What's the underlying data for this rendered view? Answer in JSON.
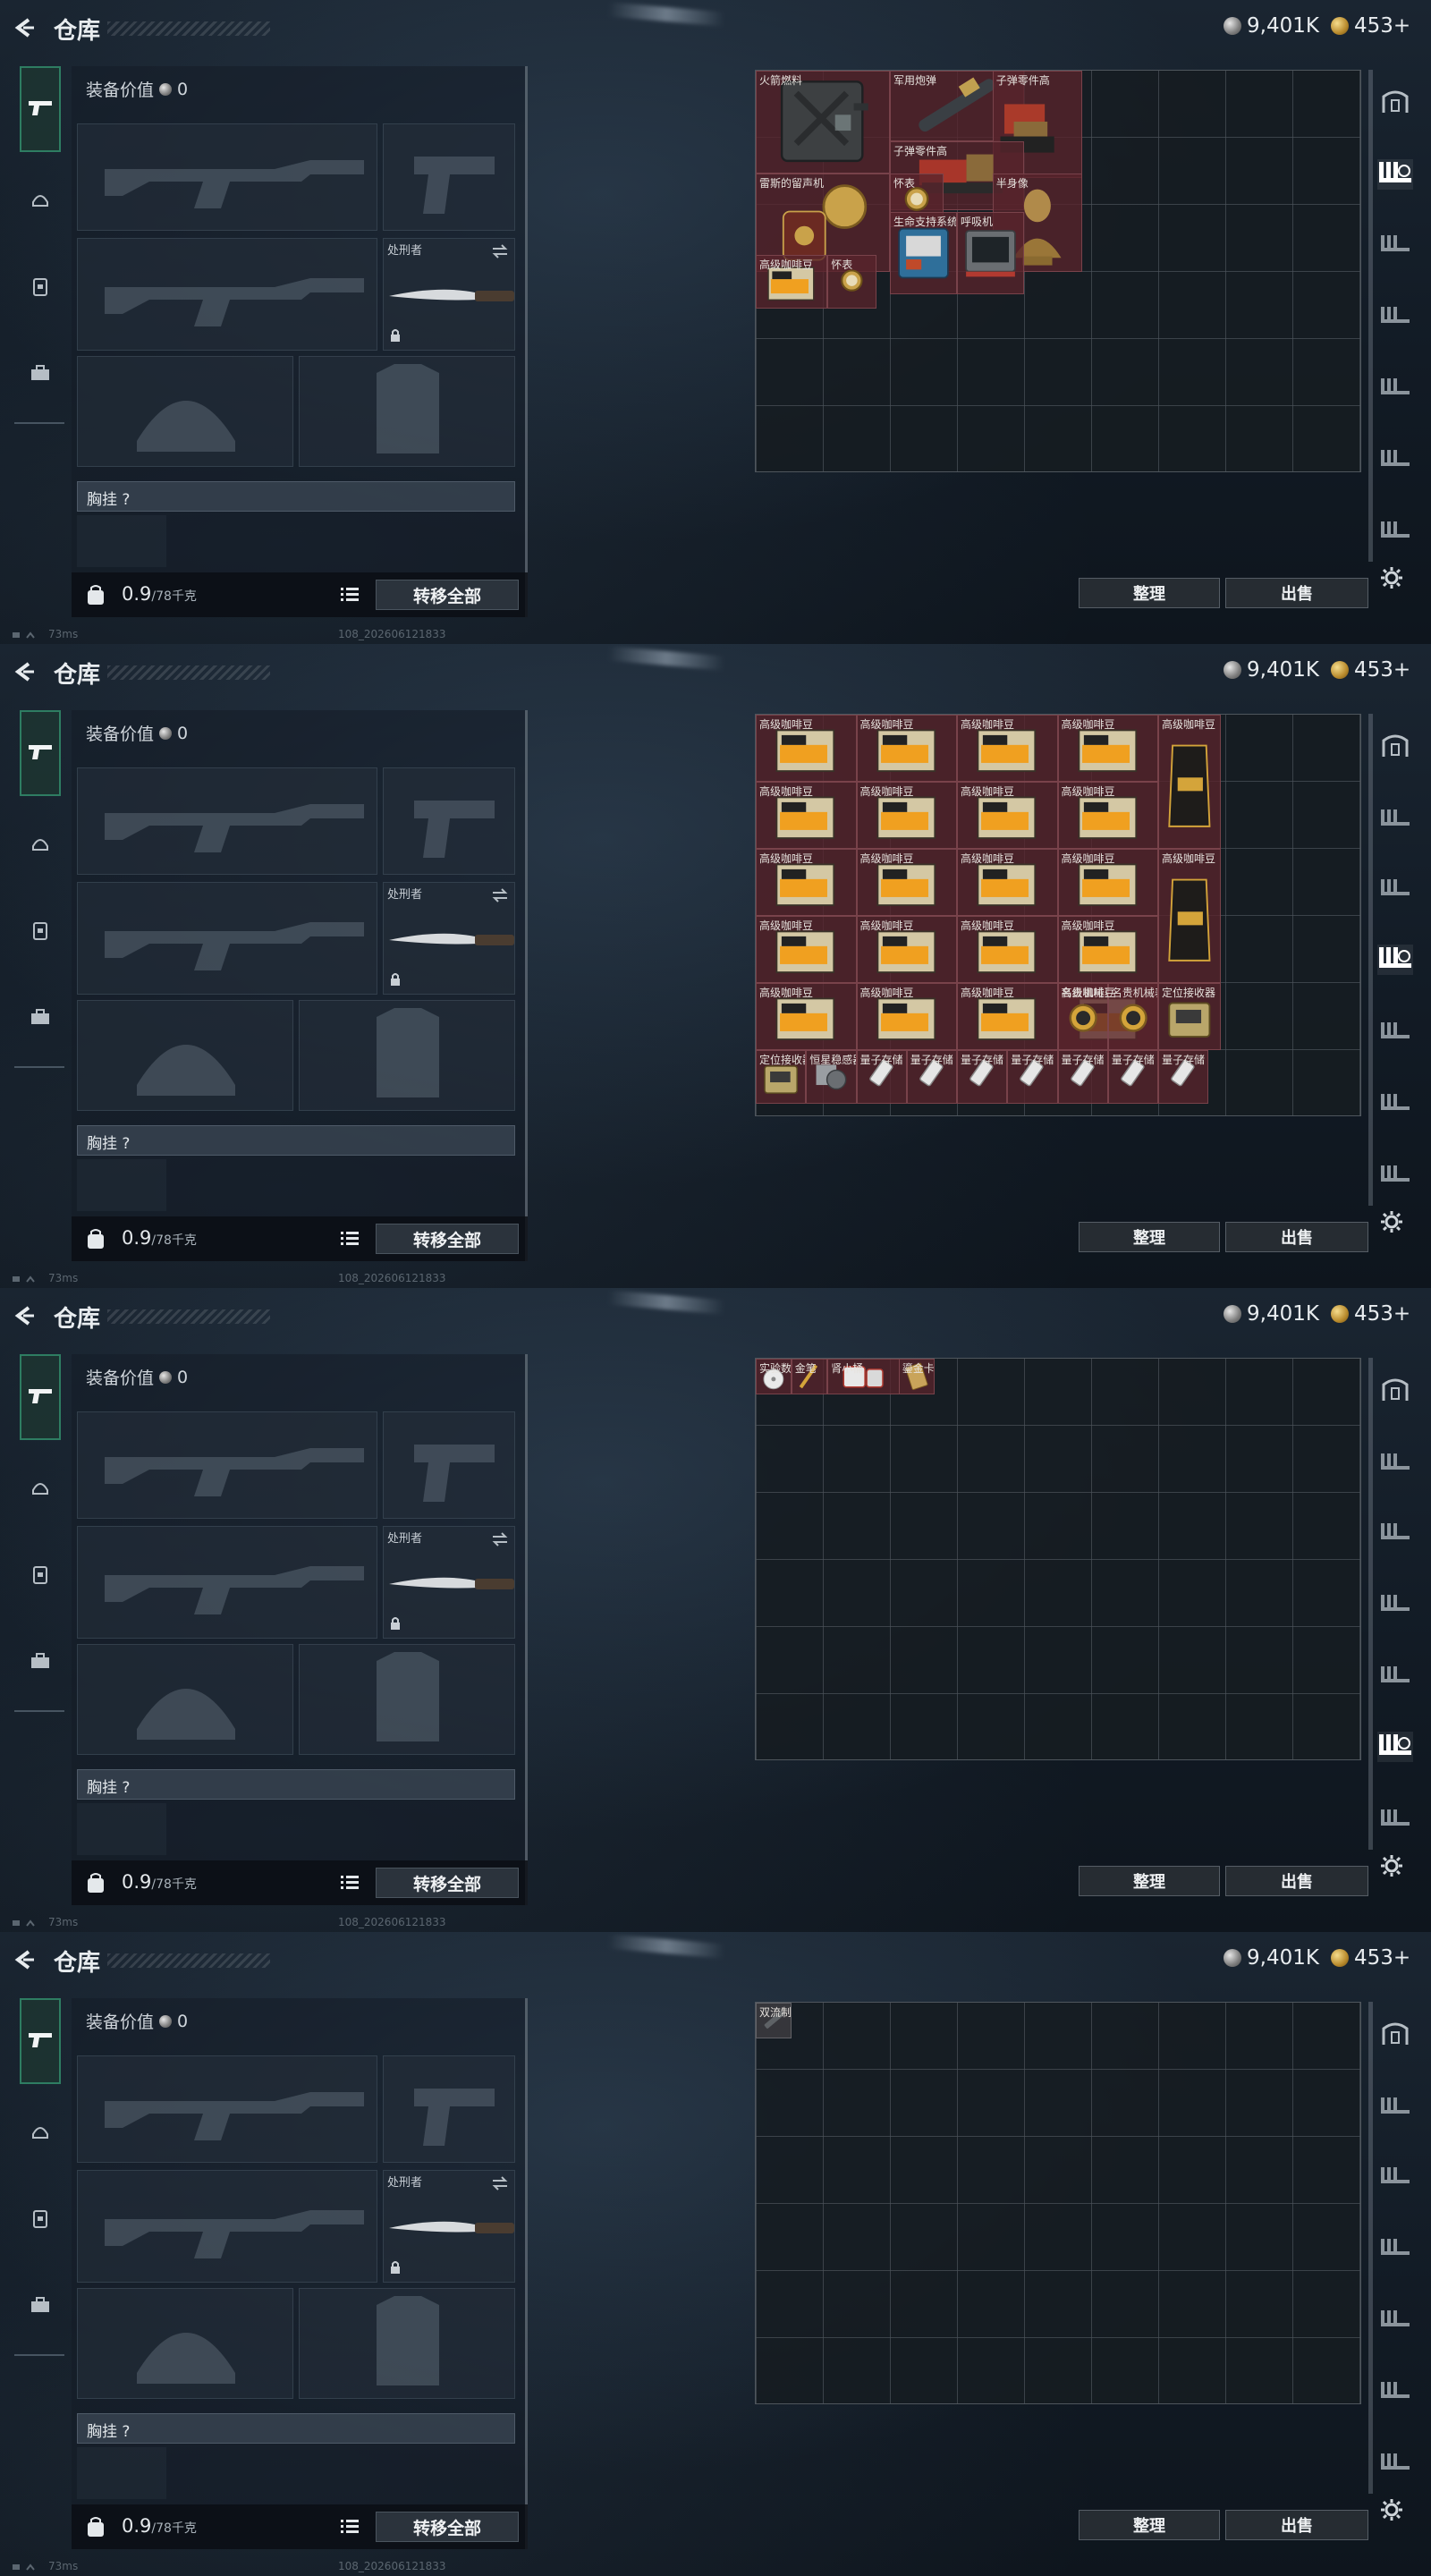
{
  "header": {
    "title": "仓库",
    "silver": "9,401K",
    "gold": "453+"
  },
  "loadout": {
    "equipment_value_label": "装备价值",
    "equipment_value": "0",
    "melee_slot_label": "处刑者",
    "chest_rig_label": "胸挂 ?",
    "weight": "0.9",
    "weight_max": "/78千克",
    "transfer_all": "转移全部"
  },
  "footer": {
    "ping": "73ms",
    "session_id": "108_202606121833"
  },
  "actions": {
    "sort": "整理",
    "sell": "出售"
  },
  "colors": {
    "accent": "#2e7d62",
    "item_cell": "#58242c",
    "gold": "#d4a43a"
  },
  "frames": [
    {
      "items": [
        {
          "name": "火箭燃料",
          "art": "jerrycan"
        },
        {
          "name": "军用炮弹",
          "art": "shell"
        },
        {
          "name": "子弹零件高",
          "art": "parts"
        },
        {
          "name": "子弹零件高",
          "art": "parts2"
        },
        {
          "name": "雷斯的留声机",
          "art": "gramophone"
        },
        {
          "name": "怀表",
          "art": "watch"
        },
        {
          "name": "半身像",
          "art": "bust"
        },
        {
          "name": "生命支持系统",
          "art": "lifesupport"
        },
        {
          "name": "呼吸机",
          "art": "ventilator"
        },
        {
          "name": "高级咖啡豆",
          "art": "coffee"
        },
        {
          "name": "怀表",
          "art": "watch"
        }
      ]
    },
    {
      "coffee_label": "高级咖啡豆",
      "watch_label": "名贵机械表",
      "locator_label": "定位接收器",
      "stabilizer_label": "恒星稳感器",
      "storage_label": "量子存储"
    },
    {
      "items": [
        {
          "name": "实验数据",
          "art": "disc"
        },
        {
          "name": "金笔",
          "art": "pen"
        },
        {
          "name": "肾小桶",
          "art": "kidney"
        },
        {
          "name": "鎏金卡牌",
          "art": "card"
        }
      ]
    },
    {
      "items": [
        {
          "name": "双流制退器",
          "art": "muzzle"
        }
      ]
    }
  ],
  "icons": {
    "back": "back-arrow-icon",
    "rail": [
      "pistol-icon",
      "helmet-icon",
      "vest-icon",
      "case-icon"
    ],
    "rrail": [
      "safe-icon",
      "rack-icon",
      "rack-icon",
      "rack-icon",
      "rack-icon",
      "rack-icon",
      "rack-icon",
      "rack-icon"
    ],
    "settings": "gear-icon"
  }
}
